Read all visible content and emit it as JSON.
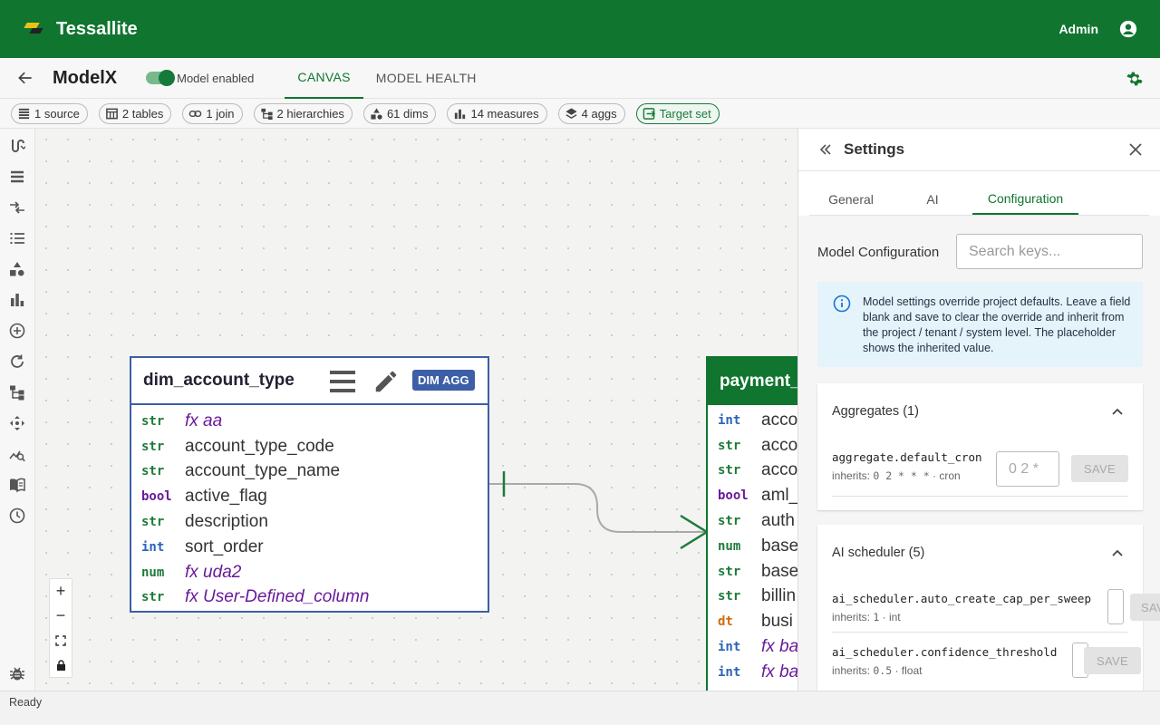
{
  "app": {
    "brand": "Tessallite",
    "user_label": "Admin"
  },
  "model": {
    "name": "ModelX",
    "toggle_label": "Model enabled",
    "tabs": [
      "CANVAS",
      "MODEL HEALTH"
    ]
  },
  "chips": [
    {
      "icon": "table-rows-icon",
      "label": "1 source"
    },
    {
      "icon": "table-grid-icon",
      "label": "2 tables"
    },
    {
      "icon": "link-icon",
      "label": "1 join"
    },
    {
      "icon": "hierarchy-icon",
      "label": "2 hierarchies"
    },
    {
      "icon": "shapes-icon",
      "label": "61 dims"
    },
    {
      "icon": "bar-chart-icon",
      "label": "14 measures"
    },
    {
      "icon": "layers-icon",
      "label": "4 aggs"
    },
    {
      "icon": "target-icon",
      "label": "Target set"
    }
  ],
  "canvas": {
    "dim_table": {
      "name": "dim_account_type",
      "badge": "DIM AGG",
      "columns": [
        {
          "type": "str",
          "name": "fx aa",
          "fx": true
        },
        {
          "type": "str",
          "name": "account_type_code",
          "fx": false
        },
        {
          "type": "str",
          "name": "account_type_name",
          "fx": false
        },
        {
          "type": "bool",
          "name": "active_flag",
          "fx": false
        },
        {
          "type": "str",
          "name": "description",
          "fx": false
        },
        {
          "type": "int",
          "name": "sort_order",
          "fx": false
        },
        {
          "type": "num",
          "name": "fx uda2",
          "fx": true
        },
        {
          "type": "str",
          "name": "fx User-Defined_column",
          "fx": true
        }
      ]
    },
    "fact_table": {
      "name": "payment_",
      "columns": [
        {
          "type": "int",
          "name": "acco",
          "fx": false
        },
        {
          "type": "str",
          "name": "acco",
          "fx": false
        },
        {
          "type": "str",
          "name": "acco",
          "fx": false
        },
        {
          "type": "bool",
          "name": "aml_",
          "fx": false
        },
        {
          "type": "str",
          "name": "auth",
          "fx": false
        },
        {
          "type": "num",
          "name": "base",
          "fx": false
        },
        {
          "type": "str",
          "name": "base",
          "fx": false
        },
        {
          "type": "str",
          "name": "billin",
          "fx": false
        },
        {
          "type": "dt",
          "name": "busi",
          "fx": false
        },
        {
          "type": "int",
          "name": "fx ba",
          "fx": true
        },
        {
          "type": "int",
          "name": "fx ba",
          "fx": true
        }
      ]
    },
    "zoom": {
      "plus": "+",
      "minus": "−"
    }
  },
  "settings": {
    "title": "Settings",
    "tabs": [
      "General",
      "AI",
      "Configuration"
    ],
    "active_tab": "Configuration",
    "model_config_label": "Model Configuration",
    "search_placeholder": "Search keys...",
    "info_text": "Model settings override project defaults. Leave a field blank and save to clear the override and inherit from the project / tenant / system level. The placeholder shows the inherited value.",
    "sections": [
      {
        "title": "Aggregates (1)",
        "entries": [
          {
            "key": "aggregate.default_cron",
            "inherits_prefix": "inherits: ",
            "inherits_value": "0 2 * * *",
            "inherits_suffix": " · cron",
            "placeholder": "0 2 *",
            "save": "SAVE"
          }
        ]
      },
      {
        "title": "AI scheduler (5)",
        "entries": [
          {
            "key": "ai_scheduler.auto_create_cap_per_sweep",
            "inherits_prefix": "inherits: ",
            "inherits_value": "1",
            "inherits_suffix": " · int",
            "placeholder": "",
            "save": "SAVE"
          },
          {
            "key": "ai_scheduler.confidence_threshold",
            "inherits_prefix": "inherits: ",
            "inherits_value": "0.5",
            "inherits_suffix": " · float",
            "placeholder": "",
            "save": "SAVE"
          }
        ]
      }
    ]
  },
  "status": {
    "text": "Ready"
  },
  "colors": {
    "brand_green": "#10752f",
    "dim_blue": "#3c5fa8",
    "fx_purple": "#6a1a9a"
  }
}
